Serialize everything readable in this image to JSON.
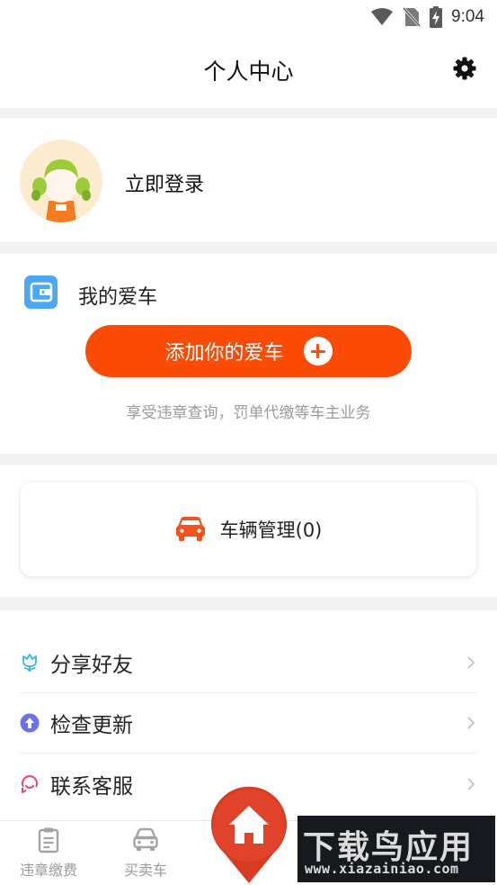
{
  "status_bar": {
    "time": "9:04",
    "icons": [
      "wifi-icon",
      "no-sim-icon",
      "battery-charging-icon"
    ]
  },
  "header": {
    "title": "个人中心",
    "settings_icon": "gear-icon"
  },
  "profile": {
    "login_label": "立即登录"
  },
  "my_car": {
    "title": "我的爱车",
    "add_button_label": "添加你的爱车",
    "hint": "享受违章查询，罚单代缴等车主业务",
    "accent_color": "#fa4b07"
  },
  "vehicle_management": {
    "label": "车辆管理(0)",
    "icon": "car-icon"
  },
  "menu": {
    "items": [
      {
        "label": "分享好友",
        "icon": "tulip-icon"
      },
      {
        "label": "检查更新",
        "icon": "upload-circle-icon"
      },
      {
        "label": "联系客服",
        "icon": "headset-smile-icon"
      }
    ]
  },
  "tabbar": {
    "tabs": [
      {
        "label": "违章缴费",
        "icon": "clipboard-icon"
      },
      {
        "label": "买卖车",
        "icon": "car-front-icon"
      }
    ],
    "home_icon": "home-icon"
  },
  "watermark": {
    "title": "下载鸟应用",
    "url": "www.xiazainiao.com"
  }
}
